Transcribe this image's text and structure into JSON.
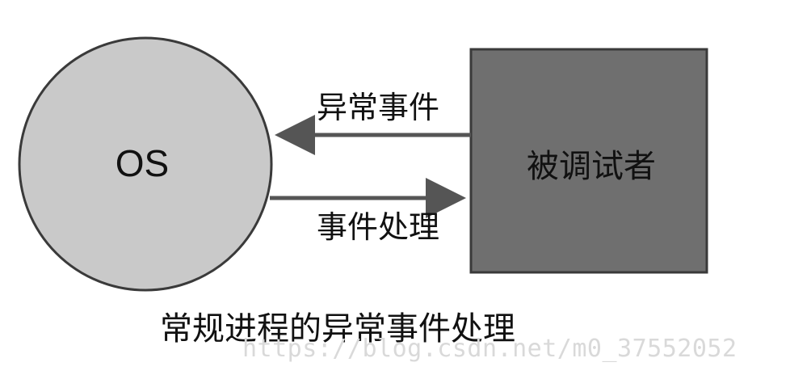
{
  "diagram": {
    "os_label": "OS",
    "debuggee_label": "被调试者",
    "arrow_top_label": "异常事件",
    "arrow_bottom_label": "事件处理",
    "caption": "常规进程的异常事件处理"
  },
  "watermark": {
    "text": "https://blog.csdn.net/m0_37552052"
  },
  "colors": {
    "circle_fill": "#c9c9c9",
    "box_fill": "#6f6f6f",
    "stroke": "#3a3a3a",
    "text": "#111111"
  }
}
